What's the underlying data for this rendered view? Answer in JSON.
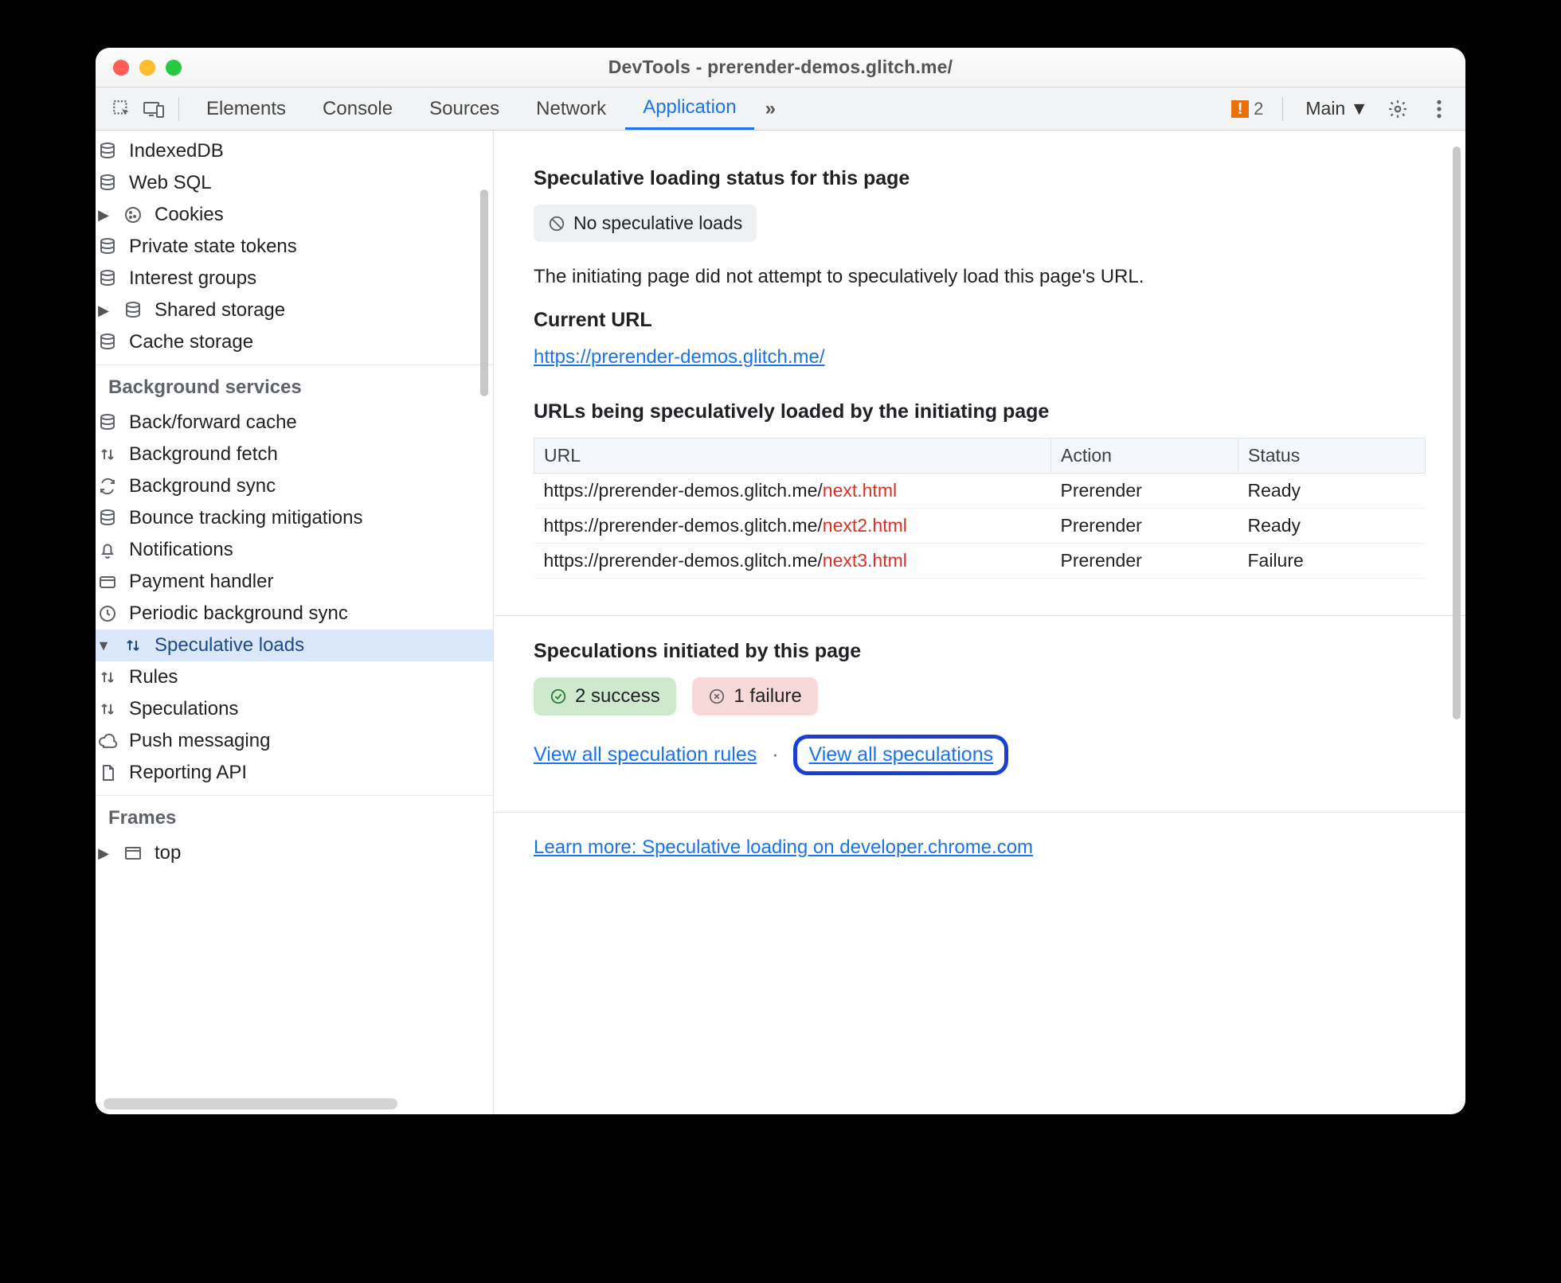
{
  "window": {
    "title": "DevTools - prerender-demos.glitch.me/"
  },
  "tabs": {
    "items": [
      "Elements",
      "Console",
      "Sources",
      "Network",
      "Application"
    ],
    "active": 4,
    "more": "»",
    "warning_count": "2",
    "context_label": "Main"
  },
  "sidebar": {
    "storage": [
      {
        "label": "IndexedDB",
        "icon": "db"
      },
      {
        "label": "Web SQL",
        "icon": "db"
      },
      {
        "label": "Cookies",
        "icon": "cookie",
        "caret": true
      },
      {
        "label": "Private state tokens",
        "icon": "db"
      },
      {
        "label": "Interest groups",
        "icon": "db"
      },
      {
        "label": "Shared storage",
        "icon": "db",
        "caret": true
      },
      {
        "label": "Cache storage",
        "icon": "db"
      }
    ],
    "bg_header": "Background services",
    "bg": [
      {
        "label": "Back/forward cache",
        "icon": "db"
      },
      {
        "label": "Background fetch",
        "icon": "updown"
      },
      {
        "label": "Background sync",
        "icon": "sync"
      },
      {
        "label": "Bounce tracking mitigations",
        "icon": "db"
      },
      {
        "label": "Notifications",
        "icon": "bell"
      },
      {
        "label": "Payment handler",
        "icon": "card"
      },
      {
        "label": "Periodic background sync",
        "icon": "clock"
      },
      {
        "label": "Speculative loads",
        "icon": "updown",
        "caret": true,
        "selected": true,
        "expanded": true,
        "children": [
          {
            "label": "Rules",
            "icon": "updown"
          },
          {
            "label": "Speculations",
            "icon": "updown"
          }
        ]
      },
      {
        "label": "Push messaging",
        "icon": "cloud"
      },
      {
        "label": "Reporting API",
        "icon": "doc"
      }
    ],
    "frames_header": "Frames",
    "frames": [
      {
        "label": "top",
        "icon": "window",
        "caret": true
      }
    ]
  },
  "panel": {
    "status_heading": "Speculative loading status for this page",
    "status_pill": "No speculative loads",
    "status_desc": "The initiating page did not attempt to speculatively load this page's URL.",
    "current_url_heading": "Current URL",
    "current_url": "https://prerender-demos.glitch.me/",
    "urls_heading": "URLs being speculatively loaded by the initiating page",
    "columns": {
      "url": "URL",
      "action": "Action",
      "status": "Status"
    },
    "rows": [
      {
        "base": "https://prerender-demos.glitch.me/",
        "file": "next.html",
        "action": "Prerender",
        "status": "Ready"
      },
      {
        "base": "https://prerender-demos.glitch.me/",
        "file": "next2.html",
        "action": "Prerender",
        "status": "Ready"
      },
      {
        "base": "https://prerender-demos.glitch.me/",
        "file": "next3.html",
        "action": "Prerender",
        "status": "Failure"
      }
    ],
    "spec_heading": "Speculations initiated by this page",
    "success_badge": "2 success",
    "failure_badge": "1 failure",
    "link_rules": "View all speculation rules",
    "link_specs": "View all speculations",
    "learn_more": "Learn more: Speculative loading on developer.chrome.com"
  }
}
